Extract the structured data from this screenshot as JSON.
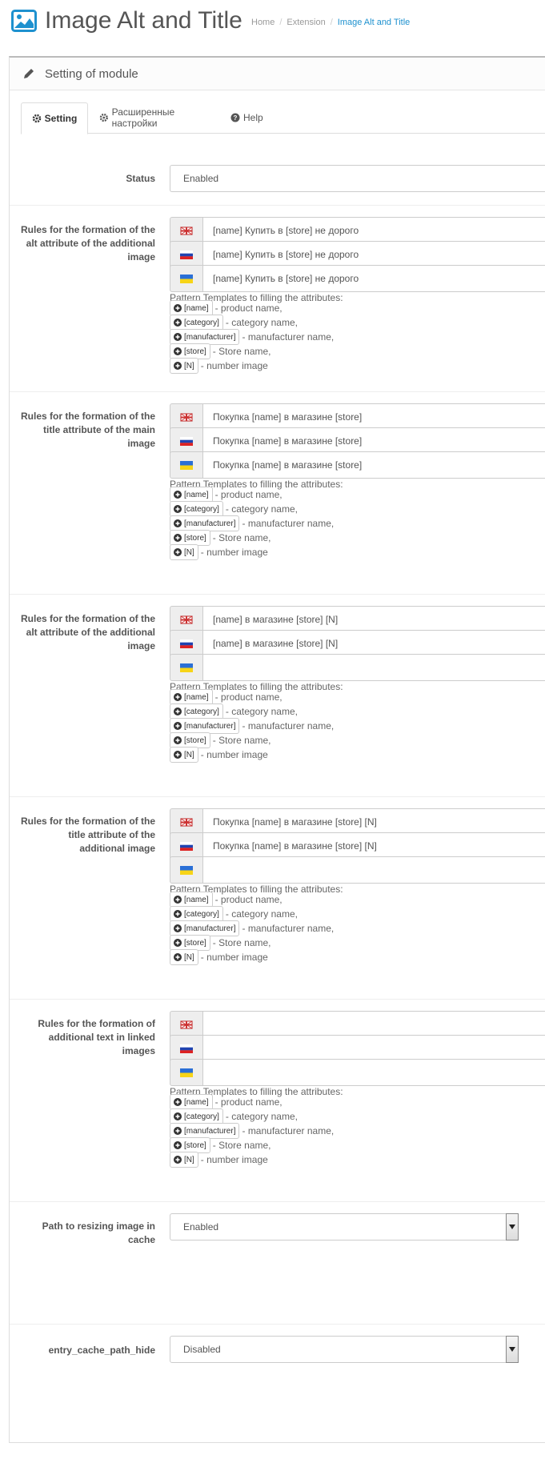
{
  "header": {
    "title": "Image Alt and Title",
    "breadcrumbs": [
      "Home",
      "Extension",
      "Image Alt and Title"
    ]
  },
  "panel": {
    "title": "Setting of module"
  },
  "tabs": [
    {
      "label": "Setting",
      "icon": "gear-icon",
      "active": true
    },
    {
      "label": "Расширенные настройки",
      "icon": "gear-icon",
      "active": false
    },
    {
      "label": "Help",
      "icon": "question-circle-icon",
      "active": false
    }
  ],
  "status": {
    "label": "Status",
    "value": "Enabled"
  },
  "pattern": {
    "title": "Pattern Templates to filling the attributes:",
    "items": [
      {
        "tag": "[name]",
        "desc": "- product name,"
      },
      {
        "tag": "[category]",
        "desc": "- category name,"
      },
      {
        "tag": "[manufacturer]",
        "desc": "- manufacturer name,"
      },
      {
        "tag": "[store]",
        "desc": "- Store name,"
      },
      {
        "tag": "[N]",
        "desc": "- number image"
      }
    ]
  },
  "groups": [
    {
      "label": "Rules for the formation of the alt attribute of the additional image",
      "values": [
        "[name] Купить в [store] не дорого",
        "[name] Купить в [store] не дорого",
        "[name] Купить в [store] не дорого"
      ]
    },
    {
      "label": "Rules for the formation of the title attribute of the main image",
      "values": [
        "Покупка  [name] в магазине [store]",
        "Покупка  [name] в магазине [store]",
        "Покупка  [name] в магазине [store]"
      ]
    },
    {
      "label": "Rules for the formation of the alt attribute of the additional image",
      "values": [
        " [name]  в магазине [store] [N]",
        " [name]  в магазине [store] [N]",
        ""
      ]
    },
    {
      "label": "Rules for the formation of the title attribute of the additional image",
      "values": [
        " Покупка [name]  в магазине [store] [N]",
        " Покупка [name]  в магазине [store] [N]",
        ""
      ]
    },
    {
      "label": "Rules for the formation of additional text in linked images",
      "values": [
        "",
        "",
        ""
      ]
    }
  ],
  "cache_path": {
    "label": "Path to resizing image in cache",
    "value": "Enabled"
  },
  "cache_hide": {
    "label": "entry_cache_path_hide",
    "value": "Disabled"
  },
  "colors": {
    "accent": "#1e91cf",
    "border": "#cccccc",
    "addon_bg": "#eeeeee"
  },
  "languages": [
    "en-flag-icon",
    "ru-flag-icon",
    "ua-flag-icon"
  ]
}
